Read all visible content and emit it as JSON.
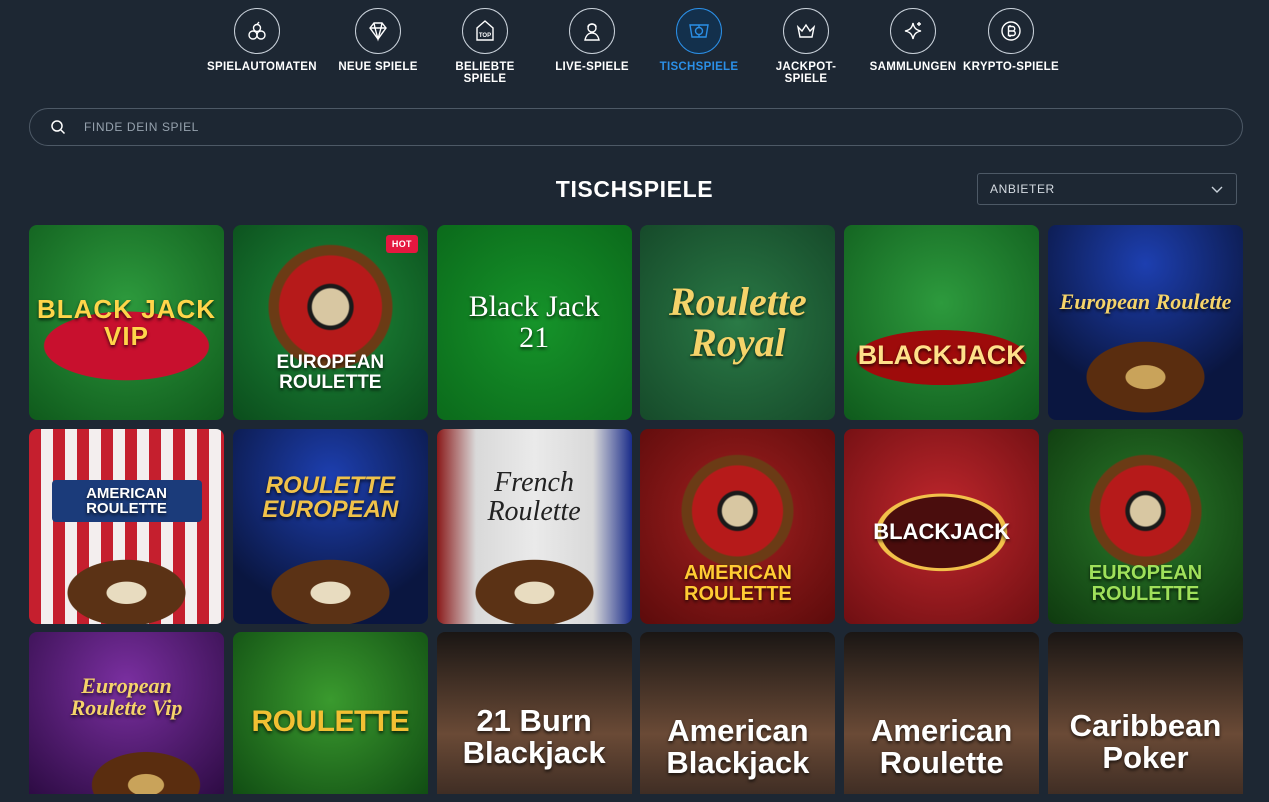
{
  "categories": [
    {
      "label": "SPIELAUTOMATEN",
      "icon": "cherries-icon",
      "active": false
    },
    {
      "label": "NEUE SPIELE",
      "icon": "diamond-icon",
      "active": false
    },
    {
      "label": "BELIEBTE SPIELE",
      "icon": "top-badge-icon",
      "active": false
    },
    {
      "label": "LIVE-SPIELE",
      "icon": "live-dealer-icon",
      "active": false
    },
    {
      "label": "TISCHSPIELE",
      "icon": "poker-chip-icon",
      "active": true
    },
    {
      "label": "JACKPOT-SPIELE",
      "icon": "crown-icon",
      "active": false
    },
    {
      "label": "SAMMLUNGEN",
      "icon": "sparkles-icon",
      "active": false
    },
    {
      "label": "KRYPTO-SPIELE",
      "icon": "bitcoin-icon",
      "active": false
    }
  ],
  "search": {
    "placeholder": "FINDE DEIN SPIEL",
    "icon": "search-icon"
  },
  "section": {
    "title": "TISCHSPIELE"
  },
  "provider_select": {
    "value": "ANBIETER",
    "icon": "chevron-down-icon"
  },
  "games": [
    {
      "title": "BLACK JACK VIP",
      "badge": ""
    },
    {
      "title": "EUROPEAN ROULETTE",
      "badge": "HOT"
    },
    {
      "title": "Black Jack 21",
      "badge": ""
    },
    {
      "title": "Roulette Royal",
      "badge": ""
    },
    {
      "title": "BLACKJACK",
      "badge": ""
    },
    {
      "title": "European Roulette",
      "badge": ""
    },
    {
      "title": "AMERICAN ROULETTE",
      "badge": ""
    },
    {
      "title": "ROULETTE EUROPEAN",
      "badge": ""
    },
    {
      "title": "French Roulette",
      "badge": ""
    },
    {
      "title": "AMERICAN ROULETTE",
      "badge": ""
    },
    {
      "title": "BLACKJACK",
      "badge": ""
    },
    {
      "title": "EUROPEAN ROULETTE",
      "badge": ""
    },
    {
      "title": "European Roulette Vip",
      "badge": ""
    },
    {
      "title": "ROULETTE",
      "badge": ""
    },
    {
      "title": "21 Burn Blackjack",
      "badge": ""
    },
    {
      "title": "American Blackjack",
      "badge": ""
    },
    {
      "title": "American Roulette",
      "badge": ""
    },
    {
      "title": "Caribbean Poker",
      "badge": ""
    }
  ],
  "colors": {
    "background": "#1d2733",
    "accent": "#2b8fe6",
    "hot": "#e5173f"
  }
}
